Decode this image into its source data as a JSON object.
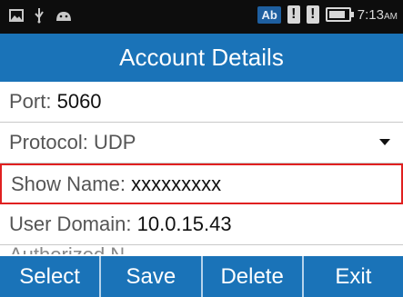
{
  "status_bar": {
    "left_icons": [
      "image-icon",
      "usb-icon",
      "android-icon"
    ],
    "input_badge": "Ab",
    "warning_glyph": "!",
    "time": "7:13",
    "ampm": "AM"
  },
  "header": {
    "title": "Account Details"
  },
  "fields": {
    "port": {
      "label": "Port:",
      "value": "5060"
    },
    "protocol": {
      "label": "Protocol:",
      "value": "UDP"
    },
    "show_name": {
      "label": "Show Name:",
      "value": "xxxxxxxxx"
    },
    "user_domain": {
      "label": "User Domain:",
      "value": "10.0.15.43"
    },
    "partial": {
      "label": "Authorized N"
    }
  },
  "footer": {
    "select": "Select",
    "save": "Save",
    "delete": "Delete",
    "exit": "Exit"
  },
  "colors": {
    "accent": "#1a73b8",
    "focus": "#e02020",
    "status_bg": "#0d0d0d"
  }
}
